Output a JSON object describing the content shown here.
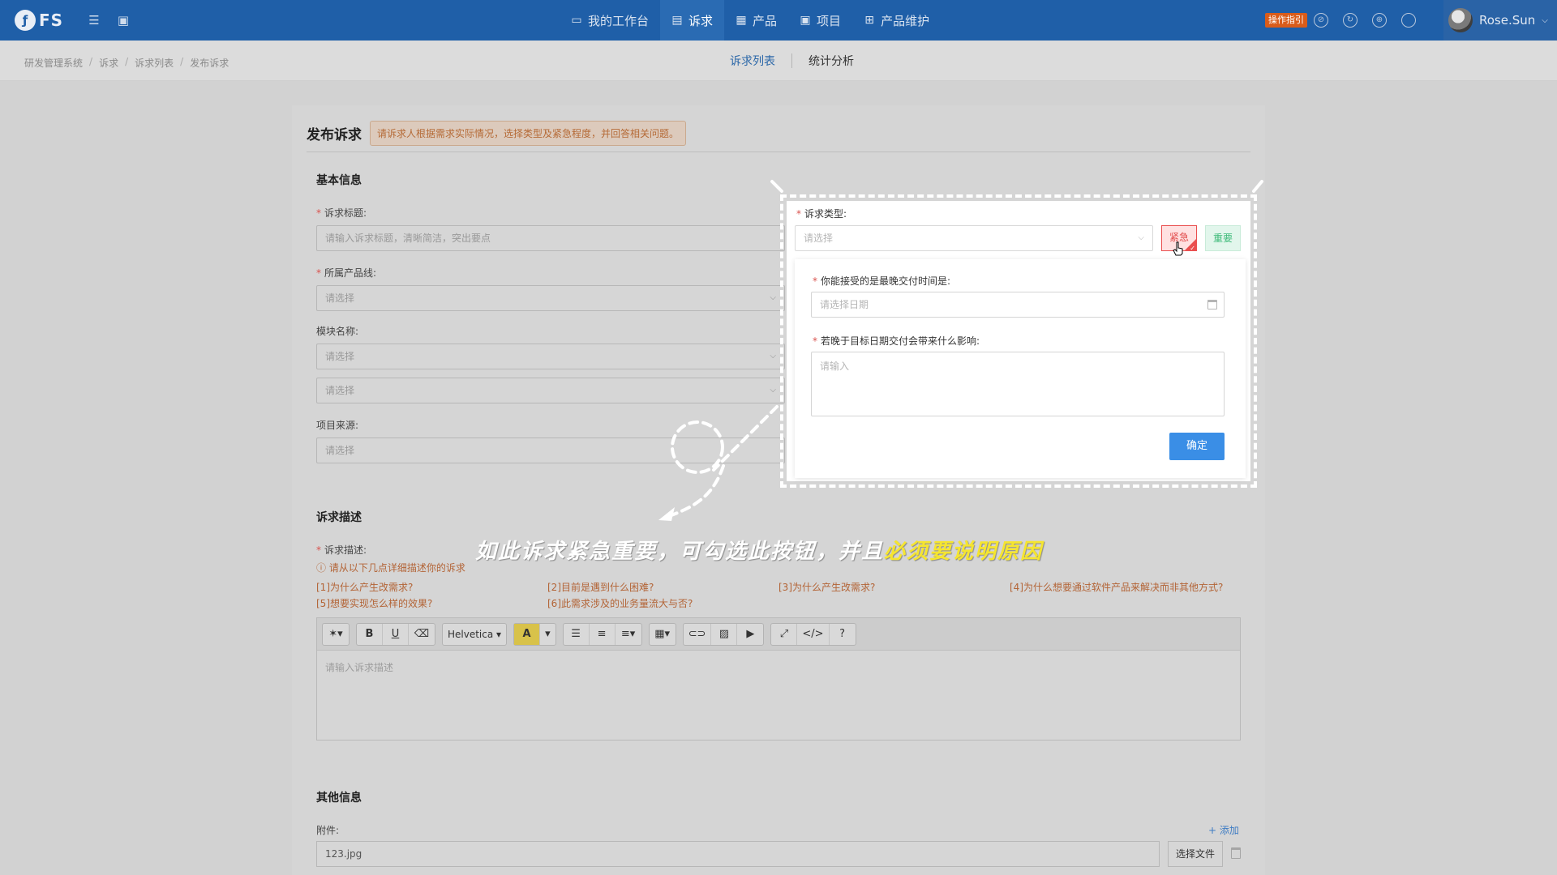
{
  "header": {
    "logo_text": "FS",
    "nav": [
      {
        "label": "我的工作台",
        "icon": "monitor-icon"
      },
      {
        "label": "诉求",
        "icon": "inbox-icon",
        "active": true
      },
      {
        "label": "产品",
        "icon": "grid-icon"
      },
      {
        "label": "项目",
        "icon": "briefcase-icon"
      },
      {
        "label": "产品维护",
        "icon": "plus-box-icon"
      }
    ],
    "guide_badge": "操作指引",
    "user_name": "Rose.Sun"
  },
  "breadcrumb": [
    "研发管理系统",
    "诉求",
    "诉求列表",
    "发布诉求"
  ],
  "subtabs": [
    {
      "label": "诉求列表",
      "active": true
    },
    {
      "label": "统计分析",
      "active": false
    }
  ],
  "form": {
    "title": "发布诉求",
    "hint": "请诉求人根据需求实际情况，选择类型及紧急程度，并回答相关问题。",
    "basic_title": "基本信息",
    "title_label": "诉求标题:",
    "title_placeholder": "请输入诉求标题，清晰简洁，突出要点",
    "product_line_label": "所属产品线:",
    "product_line_value": "请选择",
    "module_label": "模块名称:",
    "module_value_1": "请选择",
    "module_value_2": "请选择",
    "source_label": "项目来源:",
    "source_value": "请选择",
    "desc_title": "诉求描述",
    "desc_label": "诉求描述:",
    "desc_tip": "请从以下几点详细描述你的诉求",
    "desc_points": [
      "[1]为什么产生改需求?",
      "[2]目前是遇到什么困难?",
      "[3]为什么产生改需求?",
      "[4]为什么想要通过软件产品来解决而非其他方式?",
      "[5]想要实现怎么样的效果?",
      "[6]此需求涉及的业务量流大与否?"
    ],
    "editor_font": "Helvetica",
    "editor_placeholder": "请输入诉求描述",
    "other_title": "其他信息",
    "attach_label": "附件:",
    "attach_add": "+ 添加",
    "attach_file": "123.jpg",
    "attach_btn": "选择文件"
  },
  "popup": {
    "type_label": "诉求类型:",
    "type_placeholder": "请选择",
    "urgent_tag": "紧急",
    "important_tag": "重要",
    "deadline_label": "你能接受的是最晚交付时间是:",
    "deadline_placeholder": "请选择日期",
    "impact_label": "若晚于目标日期交付会带来什么影响:",
    "impact_placeholder": "请输入",
    "confirm": "确定"
  },
  "annotation": {
    "text_white": "如此诉求紧急重要，可勾选此按钮，并且",
    "text_yellow": "必须要说明原因"
  },
  "colors": {
    "topbar": "#1f5fa8",
    "urgent": "#ea4f4f",
    "important": "#3cba78",
    "primary": "#3a8ee6",
    "annotation_highlight": "#f5e530"
  }
}
